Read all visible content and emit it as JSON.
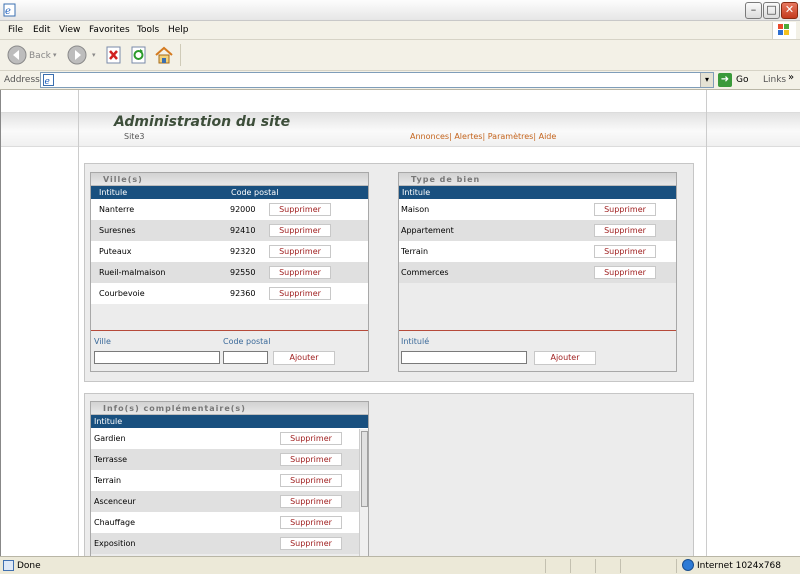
{
  "window": {
    "minimize": "–",
    "maximize": "□",
    "close": "✕"
  },
  "menu": {
    "items": [
      "File",
      "Edit",
      "View",
      "Favorites",
      "Tools",
      "Help"
    ]
  },
  "toolbar": {
    "back": "Back"
  },
  "address": {
    "label": "Address",
    "value": "",
    "go": "Go",
    "links": "Links",
    "links_more": "»"
  },
  "page": {
    "title": "Administration du site",
    "subtitle": "Site3",
    "nav": [
      "Annonces",
      "Alertes",
      "Paramètres",
      "Aide"
    ]
  },
  "villes": {
    "title": "Ville(s)",
    "col_name": "Intitule",
    "col_cp": "Code postal",
    "rows": [
      {
        "name": "Nanterre",
        "cp": "92000",
        "action": "Supprimer"
      },
      {
        "name": "Suresnes",
        "cp": "92410",
        "action": "Supprimer"
      },
      {
        "name": "Puteaux",
        "cp": "92320",
        "action": "Supprimer"
      },
      {
        "name": "Rueil-malmaison",
        "cp": "92550",
        "action": "Supprimer"
      },
      {
        "name": "Courbevoie",
        "cp": "92360",
        "action": "Supprimer"
      }
    ],
    "form_ville": "Ville",
    "form_cp": "Code postal",
    "add": "Ajouter"
  },
  "types": {
    "title": "Type de bien",
    "col_name": "Intitule",
    "rows": [
      {
        "name": "Maison",
        "action": "Supprimer"
      },
      {
        "name": "Appartement",
        "action": "Supprimer"
      },
      {
        "name": "Terrain",
        "action": "Supprimer"
      },
      {
        "name": "Commerces",
        "action": "Supprimer"
      }
    ],
    "form_label": "Intitulé",
    "add": "Ajouter"
  },
  "infos": {
    "title": "Info(s) complémentaire(s)",
    "col_name": "Intitule",
    "rows": [
      {
        "name": "Gardien",
        "action": "Supprimer"
      },
      {
        "name": "Terrasse",
        "action": "Supprimer"
      },
      {
        "name": "Terrain",
        "action": "Supprimer"
      },
      {
        "name": "Ascenceur",
        "action": "Supprimer"
      },
      {
        "name": "Chauffage",
        "action": "Supprimer"
      },
      {
        "name": "Exposition",
        "action": "Supprimer"
      }
    ]
  },
  "status": {
    "text": "Done",
    "zone": "Internet 1024x768"
  }
}
